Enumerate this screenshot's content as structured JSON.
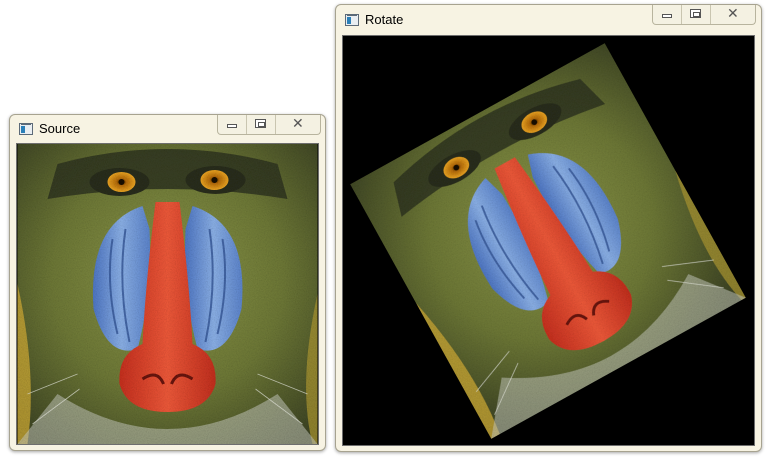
{
  "windows": {
    "source": {
      "title": "Source"
    },
    "rotate": {
      "title": "Rotate"
    }
  },
  "image": {
    "subject": "mandrill baboon face",
    "palette": {
      "fur_green": "#7f8a3f",
      "fur_dark": "#3b4125",
      "fur_yellow": "#c7a93a",
      "cheek_blue": "#6f9ad8",
      "nose_red": "#e2442c",
      "eye_orange": "#e39a1a",
      "beard_light": "#cfd2c8",
      "background_rotate": "#000000"
    }
  },
  "rotate": {
    "angle_deg": -29
  }
}
